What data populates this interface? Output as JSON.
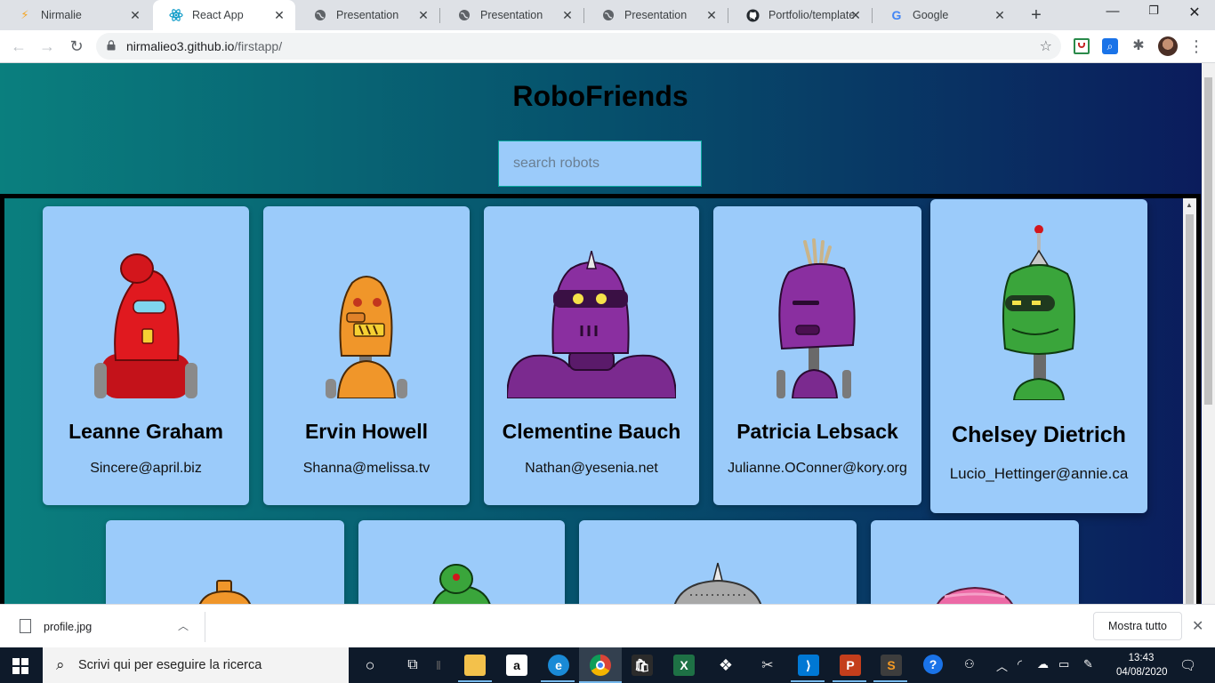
{
  "browser": {
    "tabs": [
      {
        "title": "Nirmalie",
        "icon": "bolt-icon",
        "active": false
      },
      {
        "title": "React App",
        "icon": "react-icon",
        "active": true
      },
      {
        "title": "Presentation",
        "icon": "globe-icon",
        "active": false
      },
      {
        "title": "Presentation",
        "icon": "globe-icon",
        "active": false
      },
      {
        "title": "Presentation",
        "icon": "globe-icon",
        "active": false
      },
      {
        "title": "Portfolio/template",
        "icon": "github-icon",
        "active": false
      },
      {
        "title": "Google",
        "icon": "google-icon",
        "active": false
      }
    ],
    "address": {
      "host": "nirmalieo3.github.io",
      "path": "/firstapp/"
    }
  },
  "app": {
    "title": "RoboFriends",
    "search_placeholder": "search robots",
    "robots": [
      {
        "name": "Leanne Graham",
        "email": "Sincere@april.biz",
        "color": "#d3161c"
      },
      {
        "name": "Ervin Howell",
        "email": "Shanna@melissa.tv",
        "color": "#f0962a"
      },
      {
        "name": "Clementine Bauch",
        "email": "Nathan@yesenia.net",
        "color": "#7b2a8f"
      },
      {
        "name": "Patricia Lebsack",
        "email": "Julianne.OConner@kory.org",
        "color": "#7b2a8f"
      },
      {
        "name": "Chelsey Dietrich",
        "email": "Lucio_Hettinger@annie.ca",
        "color": "#3aa53b"
      },
      {
        "name": "",
        "email": "",
        "color": "#f0962a"
      },
      {
        "name": "",
        "email": "",
        "color": "#3aa53b"
      },
      {
        "name": "",
        "email": "",
        "color": "#a8a8a8"
      },
      {
        "name": "",
        "email": "",
        "color": "#ec6aa6"
      }
    ]
  },
  "download_bar": {
    "file": "profile.jpg",
    "show_all": "Mostra tutto"
  },
  "taskbar": {
    "search_text": "Scrivi qui per eseguire la ricerca",
    "time": "13:43",
    "date": "04/08/2020"
  }
}
